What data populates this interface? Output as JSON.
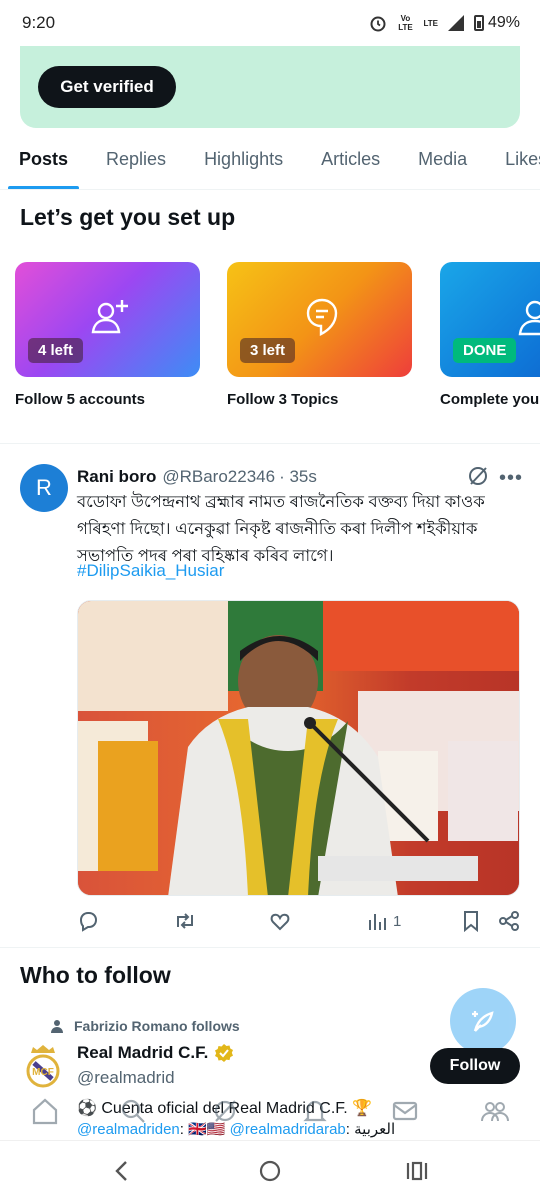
{
  "status_bar": {
    "time": "9:20",
    "network": "LTE",
    "volte": "Vo LTE",
    "battery": "49%"
  },
  "banner": {
    "button_label": "Get verified",
    "background": "#c6f0dc"
  },
  "tabs": [
    {
      "label": "Posts",
      "active": true
    },
    {
      "label": "Replies",
      "active": false
    },
    {
      "label": "Highlights",
      "active": false
    },
    {
      "label": "Articles",
      "active": false
    },
    {
      "label": "Media",
      "active": false
    },
    {
      "label": "Likes",
      "active": false
    }
  ],
  "setup": {
    "title": "Let’s get you set up",
    "cards": [
      {
        "badge": "4 left",
        "label": "Follow 5 accounts",
        "icon": "add-user-icon"
      },
      {
        "badge": "3 left",
        "label": "Follow 3 Topics",
        "icon": "topic-icon"
      },
      {
        "badge": "DONE",
        "label": "Complete your profile",
        "icon": "profile-icon"
      }
    ]
  },
  "tweet": {
    "avatar_letter": "R",
    "name": "Rani boro",
    "handle": "@RBaro22346",
    "time": "· 35s",
    "text": "বডোফা উপেন্দ্রনাথ ব্ৰহ্মাৰ নামত ৰাজনৈতিক বক্তব্য দিয়া কাওক গৰিহণা দিছো। এনেকুৱা নিকৃষ্ট ৰাজনীতি কৰা দিলীপ শইকীয়াক সভাপতি পদৰ পৰা বহিষ্কাৰ কৰিব লাগে।",
    "hashtag": "#DilipSaikia_Husiar",
    "views": "1"
  },
  "who_to_follow": {
    "title": "Who to follow",
    "social_context": "Fabrizio Romano follows",
    "account": {
      "name": "Real Madrid C.F.",
      "handle": "@realmadrid",
      "bio": "⚽ Cuenta oficial del Real Madrid C.F. 🏆",
      "bio_link1": "@realmadriden",
      "bio_flags": ": 🇬🇧🇺🇸",
      "bio_link2": "@realmadridarab",
      "bio_tail": ": العربية",
      "follow_label": "Follow"
    }
  },
  "colors": {
    "accent": "#1d9bf0",
    "text": "#0f1419",
    "muted": "#536471"
  }
}
